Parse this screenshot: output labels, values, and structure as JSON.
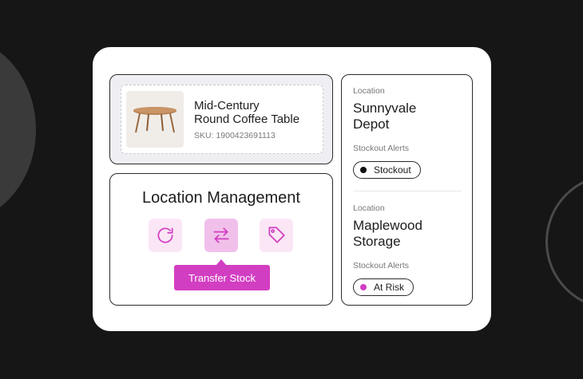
{
  "product": {
    "name": "Mid-Century\nRound Coffee Table",
    "sku": "SKU: 1900423691113",
    "image": "round-coffee-table"
  },
  "management": {
    "title": "Location Management",
    "actions": [
      {
        "icon": "refresh-icon",
        "active": false
      },
      {
        "icon": "transfer-arrows-icon",
        "active": true
      },
      {
        "icon": "tag-icon",
        "active": false
      }
    ],
    "tooltip": "Transfer Stock"
  },
  "locations": [
    {
      "label": "Location",
      "name": "Sunnyvale\nDepot",
      "alerts_label": "Stockout Alerts",
      "status": "Stockout",
      "status_color": "#111111"
    },
    {
      "label": "Location",
      "name": "Maplewood\nStorage",
      "alerts_label": "Stockout Alerts",
      "status": "At Risk",
      "status_color": "#d23ec2"
    }
  ],
  "colors": {
    "accent": "#d23ec2",
    "accent_light": "#fbe6f6",
    "background": "#161616"
  }
}
